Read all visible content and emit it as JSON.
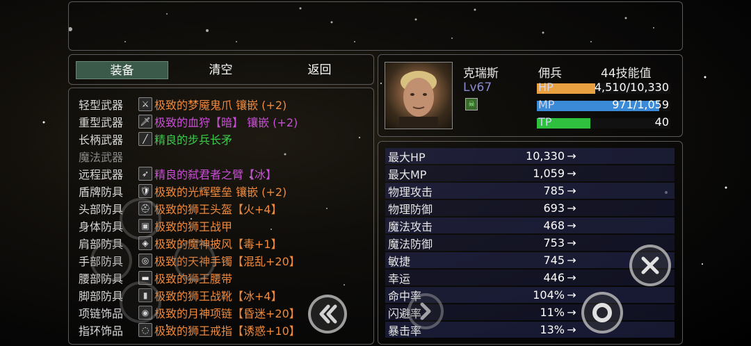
{
  "tabs": {
    "equip": "装备",
    "clear": "清空",
    "back": "返回"
  },
  "equipment": [
    {
      "slot": "轻型武器",
      "icon": "light-weapon-icon",
      "name": "极致的梦魇鬼爪 镶嵌 (+2)",
      "rarity": "orange"
    },
    {
      "slot": "重型武器",
      "icon": "heavy-weapon-icon",
      "name": "极致的血狩【暗】 镶嵌 (+2)",
      "rarity": "purple"
    },
    {
      "slot": "长柄武器",
      "icon": "polearm-icon",
      "name": "精良的步兵长矛",
      "rarity": "green"
    },
    {
      "slot": "魔法武器",
      "icon": "",
      "name": "",
      "rarity": "none"
    },
    {
      "slot": "远程武器",
      "icon": "ranged-weapon-icon",
      "name": "精良的弑君者之臂【冰】",
      "rarity": "purple"
    },
    {
      "slot": "盾牌防具",
      "icon": "shield-icon",
      "name": "极致的光辉壁垒 镶嵌 (+2)",
      "rarity": "orange"
    },
    {
      "slot": "头部防具",
      "icon": "helmet-icon",
      "name": "极致的狮王头盔【火+4】",
      "rarity": "orange"
    },
    {
      "slot": "身体防具",
      "icon": "armor-icon",
      "name": "极致的狮王战甲",
      "rarity": "orange"
    },
    {
      "slot": "肩部防具",
      "icon": "cloak-icon",
      "name": "极致的魔神披风【毒+1】",
      "rarity": "orange"
    },
    {
      "slot": "手部防具",
      "icon": "bracer-icon",
      "name": "极致的天神手镯【混乱+20】",
      "rarity": "orange"
    },
    {
      "slot": "腰部防具",
      "icon": "belt-icon",
      "name": "极致的狮王腰带",
      "rarity": "orange"
    },
    {
      "slot": "脚部防具",
      "icon": "boots-icon",
      "name": "极致的狮王战靴【冰+4】",
      "rarity": "orange"
    },
    {
      "slot": "项链饰品",
      "icon": "necklace-icon",
      "name": "极致的月神项链【昏迷+20】",
      "rarity": "orange"
    },
    {
      "slot": "指环饰品",
      "icon": "ring-icon",
      "name": "极致的狮王戒指【诱惑+10】",
      "rarity": "orange"
    }
  ],
  "character": {
    "name": "克瑞斯",
    "class": "佣兵",
    "skill_points": "44技能值",
    "level": "Lv67",
    "hp": {
      "label": "HP",
      "value": "4,510/10,330",
      "fraction": 0.437,
      "color": "#e8a040"
    },
    "mp": {
      "label": "MP",
      "value": "971/1,059",
      "fraction": 0.917,
      "color": "#3a8ad8"
    },
    "tp": {
      "label": "TP",
      "value": "40",
      "fraction": 0.4,
      "color": "#30c040"
    }
  },
  "stats": [
    {
      "name": "最大HP",
      "value": "10,330",
      "arrow": "→"
    },
    {
      "name": "最大MP",
      "value": "1,059",
      "arrow": "→"
    },
    {
      "name": "物理攻击",
      "value": "785",
      "arrow": "→"
    },
    {
      "name": "物理防御",
      "value": "693",
      "arrow": "→"
    },
    {
      "name": "魔法攻击",
      "value": "468",
      "arrow": "→"
    },
    {
      "name": "魔法防御",
      "value": "753",
      "arrow": "→"
    },
    {
      "name": "敏捷",
      "value": "745",
      "arrow": "→"
    },
    {
      "name": "幸运",
      "value": "446",
      "arrow": "→"
    },
    {
      "name": "命中率",
      "value": "104%",
      "arrow": "→"
    },
    {
      "name": "闪避率",
      "value": "11%",
      "arrow": "→"
    },
    {
      "name": "暴击率",
      "value": "13%",
      "arrow": "→"
    }
  ],
  "controls": {
    "cancel": "close-icon",
    "confirm": "circle-icon",
    "prev": "double-chevron-left-icon",
    "next": "chevron-right-icon"
  }
}
